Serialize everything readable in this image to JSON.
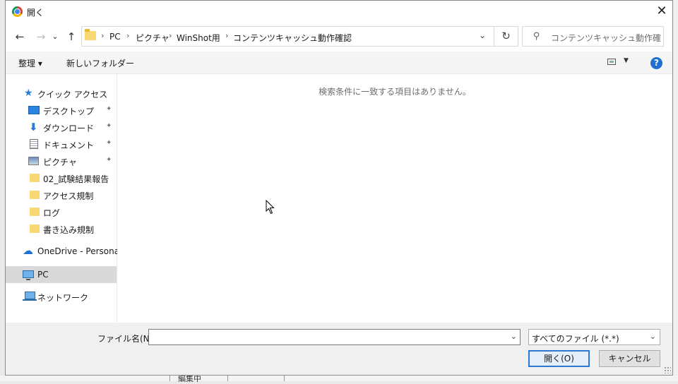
{
  "dialog": {
    "title": "開く",
    "close_glyph": "✕"
  },
  "navigation": {
    "back_glyph": "←",
    "forward_glyph": "→",
    "recent_glyph": "⌄",
    "up_glyph": "↑",
    "refresh_glyph": "↻",
    "breadcrumbs": [
      "PC",
      "ピクチャ",
      "WinShot用",
      "コンテンツキャッシュ動作確認"
    ],
    "separator": "›",
    "search_placeholder": "コンテンツキャッシュ動作確認の..."
  },
  "toolbar": {
    "organize_label": "整理 ▾",
    "new_folder_label": "新しいフォルダー",
    "help_glyph": "?"
  },
  "sidebar": {
    "quick_access": "クイック アクセス",
    "items": [
      {
        "label": "デスクトップ",
        "icon": "desktop-icon",
        "pinned": true
      },
      {
        "label": "ダウンロード",
        "icon": "download-icon",
        "pinned": true
      },
      {
        "label": "ドキュメント",
        "icon": "document-icon",
        "pinned": true
      },
      {
        "label": "ピクチャ",
        "icon": "pictures-icon",
        "pinned": true
      },
      {
        "label": "02_試験結果報告",
        "icon": "folder-icon",
        "pinned": false
      },
      {
        "label": "アクセス規制",
        "icon": "folder-icon",
        "pinned": false
      },
      {
        "label": "ログ",
        "icon": "folder-icon",
        "pinned": false
      },
      {
        "label": "書き込み規制",
        "icon": "folder-icon",
        "pinned": false
      }
    ],
    "onedrive": "OneDrive - Personal",
    "pc": "PC",
    "network": "ネットワーク",
    "pin_glyph": "📌"
  },
  "content": {
    "empty_message": "検索条件に一致する項目はありません。"
  },
  "footer": {
    "filename_label": "ファイル名(N):",
    "filename_value": "",
    "filetype_value": "すべてのファイル (*.*)",
    "open_button": "開く(O)",
    "cancel_button": "キャンセル",
    "dropdown_glyph": "⌄"
  },
  "background": {
    "peek_text": "編集中"
  }
}
